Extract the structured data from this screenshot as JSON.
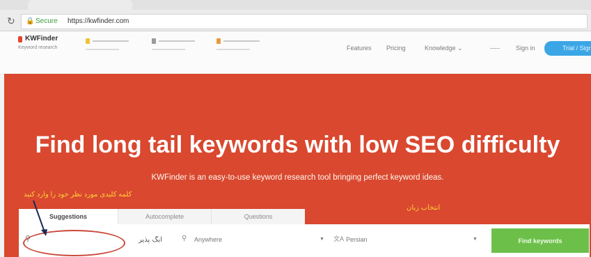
{
  "browser": {
    "secure_label": "Secure",
    "url": "https://kwfinder.com",
    "lock_icon": "lock-icon",
    "reload_icon": "reload-icon"
  },
  "nav": {
    "logo_name": "KWFinder",
    "logo_tagline": "Keyword research",
    "products": [
      "",
      "",
      ""
    ],
    "links": [
      "Features",
      "Pricing",
      "Knowledge ⌄",
      "Sign in"
    ],
    "cta_label": "Trial / Signup"
  },
  "hero": {
    "headline": "Find long tail keywords with low SEO difficulty",
    "subheadline": "KWFinder is an easy-to-use keyword research tool bringing perfect keyword ideas.",
    "background_color": "#d9482f"
  },
  "annotations": {
    "keyword_hint": "کلمه کلیدی مورد نظر خود را وارد کنید",
    "language_hint": "انتخاب زبان",
    "annotation_color": "#ffd23a"
  },
  "search": {
    "tabs": [
      "Suggestions",
      "Autocomplete",
      "Questions"
    ],
    "active_tab": "Suggestions",
    "keyword_value": "آبگ پذیر",
    "keyword_icon": "search-icon",
    "location_value": "Anywhere",
    "location_icon": "location-pin-icon",
    "language_value": "Persian",
    "language_icon": "language-icon",
    "dropdown_icon": "caret-down-icon",
    "find_button_label": "Find keywords",
    "find_button_color": "#6cc04a"
  }
}
